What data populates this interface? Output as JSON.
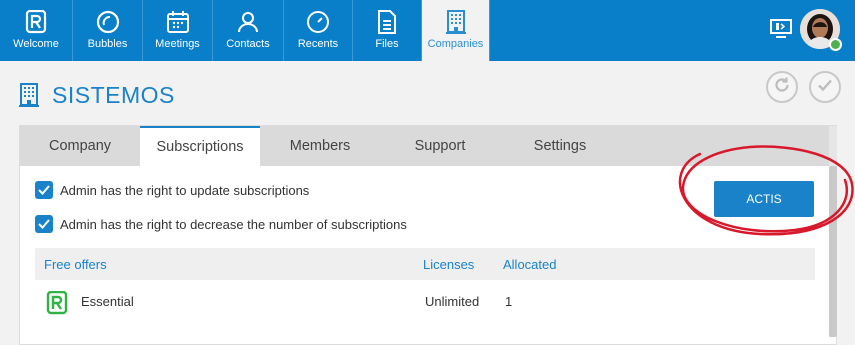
{
  "nav": {
    "items": [
      {
        "label": "Welcome",
        "icon": "rainbow-logo-icon",
        "active": false
      },
      {
        "label": "Bubbles",
        "icon": "bubble-icon",
        "active": false
      },
      {
        "label": "Meetings",
        "icon": "calendar-icon",
        "active": false
      },
      {
        "label": "Contacts",
        "icon": "person-icon",
        "active": false
      },
      {
        "label": "Recents",
        "icon": "clock-icon",
        "active": false
      },
      {
        "label": "Files",
        "icon": "file-icon",
        "active": false
      },
      {
        "label": "Companies",
        "icon": "building-icon",
        "active": true
      }
    ]
  },
  "header": {
    "screen_icon": "screen-share-icon",
    "avatar": "user-avatar",
    "status": "online"
  },
  "page": {
    "title": "SISTEMOS",
    "title_icon": "building-icon"
  },
  "actions": {
    "refresh_icon": "refresh-icon",
    "confirm_icon": "check-icon"
  },
  "tabs": [
    "Company",
    "Subscriptions",
    "Members",
    "Support",
    "Settings"
  ],
  "active_tab": "Subscriptions",
  "checks": [
    {
      "label": "Admin has the right to update subscriptions",
      "checked": true
    },
    {
      "label": "Admin has the right to decrease the number of subscriptions",
      "checked": true
    }
  ],
  "actis_button": {
    "label": "ACTIS"
  },
  "table": {
    "headers": {
      "offer": "Free offers",
      "licenses": "Licenses",
      "allocated": "Allocated"
    },
    "rows": [
      {
        "name": "Essential",
        "licenses": "Unlimited",
        "allocated": "1",
        "icon": "rainbow-logo-icon"
      }
    ]
  },
  "colors": {
    "accent": "#0a7fc9",
    "annotation": "#d7192b",
    "status": "#4caf50"
  }
}
